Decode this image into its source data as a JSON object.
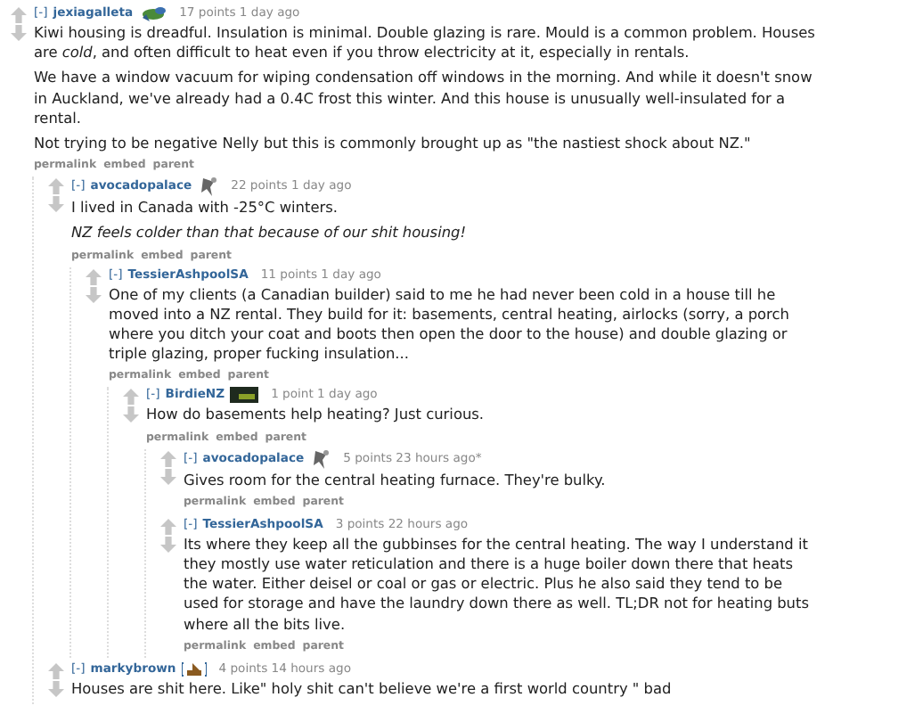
{
  "comments": [
    {
      "collapse": "[-]",
      "author": "jexiagalleta",
      "flair": {
        "kind": "bird"
      },
      "score": "17 points 1 day ago",
      "paragraphs": [
        {
          "text": "Kiwi housing is dreadful. Insulation is minimal. Double glazing is rare. Mould is a common problem. Houses are *cold*, and often difficult to heat even if you throw electricity at it, especially in rentals.",
          "italic": false
        },
        {
          "text": "We have a window vacuum for wiping condensation off windows in the morning. And while it doesn't snow in Auckland, we've already had a 0.4C frost this winter. And this house is unusually well-insulated for a rental.",
          "italic": false
        },
        {
          "text": "Not trying to be negative Nelly but this is commonly brought up as \"the nastiest shock about NZ.\"",
          "italic": false
        }
      ],
      "buttons": [
        "permalink",
        "embed",
        "parent"
      ],
      "children": [
        {
          "collapse": "[-]",
          "author": "avocadopalace",
          "flair": {
            "kind": "figure"
          },
          "score": "22 points 1 day ago",
          "paragraphs": [
            {
              "text": "I lived in Canada with -25°C winters.",
              "italic": false
            },
            {
              "text": "NZ feels colder than that because of our shit housing!",
              "italic": true
            }
          ],
          "buttons": [
            "permalink",
            "embed",
            "parent"
          ],
          "children": [
            {
              "collapse": "[-]",
              "author": "TessierAshpoolSA",
              "score": "11 points 1 day ago",
              "paragraphs": [
                {
                  "text": "One of my clients (a Canadian builder) said to me he had never been cold in a house till he moved into a NZ rental. They build for it: basements, central heating, airlocks (sorry, a porch where you ditch your coat and boots then open the door to the house) and double glazing or triple glazing, proper fucking insulation...",
                  "italic": false
                }
              ],
              "buttons": [
                "permalink",
                "embed",
                "parent"
              ],
              "children": [
                {
                  "collapse": "[-]",
                  "author": "BirdieNZ",
                  "flair": {
                    "kind": "badge"
                  },
                  "score": "1 point 1 day ago",
                  "paragraphs": [
                    {
                      "text": "How do basements help heating? Just curious.",
                      "italic": false
                    }
                  ],
                  "buttons": [
                    "permalink",
                    "embed",
                    "parent"
                  ],
                  "children": [
                    {
                      "collapse": "[-]",
                      "author": "avocadopalace",
                      "flair": {
                        "kind": "figure"
                      },
                      "score": "5 points 23 hours ago*",
                      "paragraphs": [
                        {
                          "text": "Gives room for the central heating furnace. They're bulky.",
                          "italic": false
                        }
                      ],
                      "buttons": [
                        "permalink",
                        "embed",
                        "parent"
                      ]
                    },
                    {
                      "collapse": "[-]",
                      "author": "TessierAshpoolSA",
                      "score": "3 points 22 hours ago",
                      "paragraphs": [
                        {
                          "text": "Its where they keep all the gubbinses for the central heating. The way I understand it they mostly use water reticulation and there is a huge boiler down there that heats the water. Either deisel or coal or gas or electric. Plus he also said they tend to be used for storage and have the laundry down there as well. TL;DR not for heating buts where all the bits live.",
                          "italic": false
                        }
                      ],
                      "buttons": [
                        "permalink",
                        "embed",
                        "parent"
                      ]
                    }
                  ]
                }
              ]
            }
          ]
        },
        {
          "collapse": "[-]",
          "author": "markybrown",
          "flair": {
            "kind": "boat"
          },
          "score": "4 points 14 hours ago",
          "paragraphs": [
            {
              "text": "Houses are shit here. Like\" holy shit can't believe we're a first world country \" bad",
              "italic": false
            }
          ]
        }
      ]
    }
  ]
}
